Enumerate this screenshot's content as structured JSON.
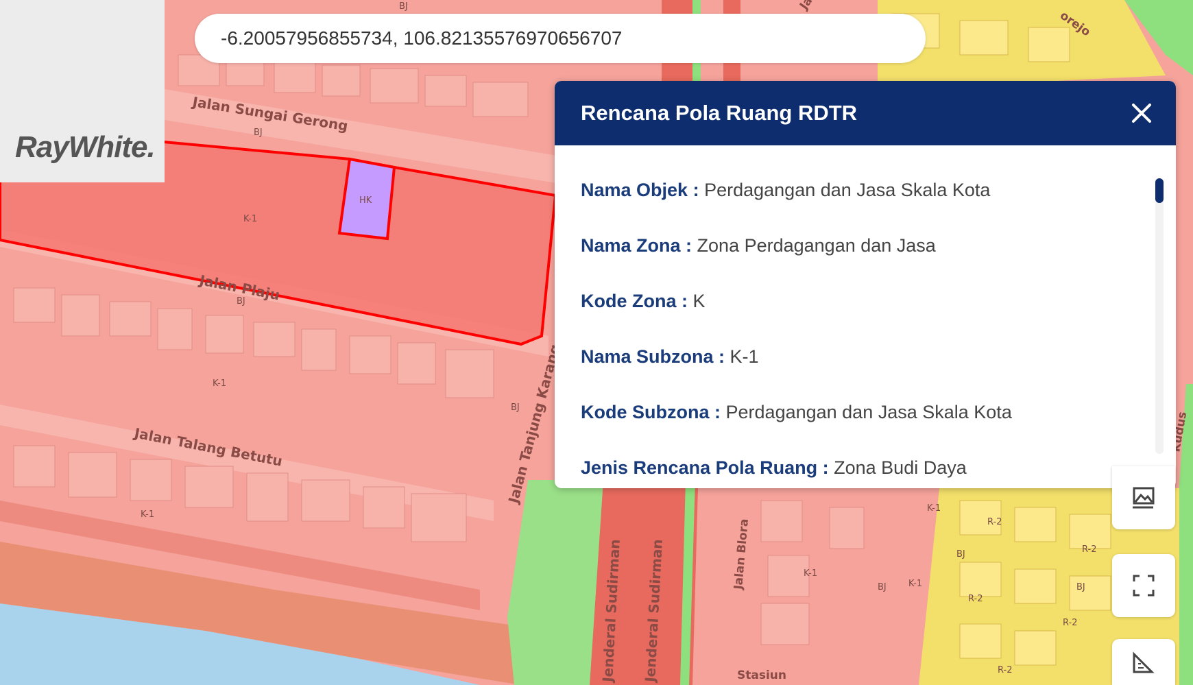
{
  "search": {
    "value": "-6.20057956855734, 106.82135576970656707"
  },
  "branding": {
    "logo_text": "RayWhite",
    "logo_mark": "."
  },
  "popup": {
    "title": "Rencana Pola Ruang RDTR",
    "fields": [
      {
        "label": "Nama Objek :",
        "value": "Perdagangan dan Jasa Skala Kota"
      },
      {
        "label": "Nama Zona :",
        "value": "Zona Perdagangan dan Jasa"
      },
      {
        "label": "Kode Zona :",
        "value": "K"
      },
      {
        "label": "Nama Subzona :",
        "value": "K-1"
      },
      {
        "label": "Kode Subzona :",
        "value": "Perdagangan dan Jasa Skala Kota"
      },
      {
        "label": "Jenis Rencana Pola Ruang :",
        "value": "Zona Budi Daya"
      }
    ]
  },
  "map": {
    "streets": {
      "sungai_gerong": "Jalan Sungai Gerong",
      "plaju": "Jalan Plaju",
      "talang_betutu": "Jalan Talang Betutu",
      "tanjung_karang": "Jalan Tanjung Karang",
      "sudirman_1": "Jenderal Sudirman",
      "sudirman_2": "Jenderal Sudirman",
      "blora": "Jalan Blora",
      "stasiun": "Stasiun",
      "kudus": "Kudus",
      "orejo": "orejo",
      "ja1": "Ja",
      "ja2": "Ja"
    },
    "zone_labels": {
      "hk": "HK",
      "k1": "K-1",
      "bj": "BJ",
      "r2": "R-2"
    }
  },
  "icons": {
    "close": "close-icon",
    "layers": "image-layer-icon",
    "fullscreen": "fullscreen-icon",
    "measure": "measure-icon"
  },
  "colors": {
    "header": "#0e2d6e",
    "label": "#1a3c7a",
    "commercial_zone": "#f08080",
    "residential_zone": "#f5e06a",
    "green_zone": "#8ee07e",
    "highlight": "#ff0000"
  }
}
